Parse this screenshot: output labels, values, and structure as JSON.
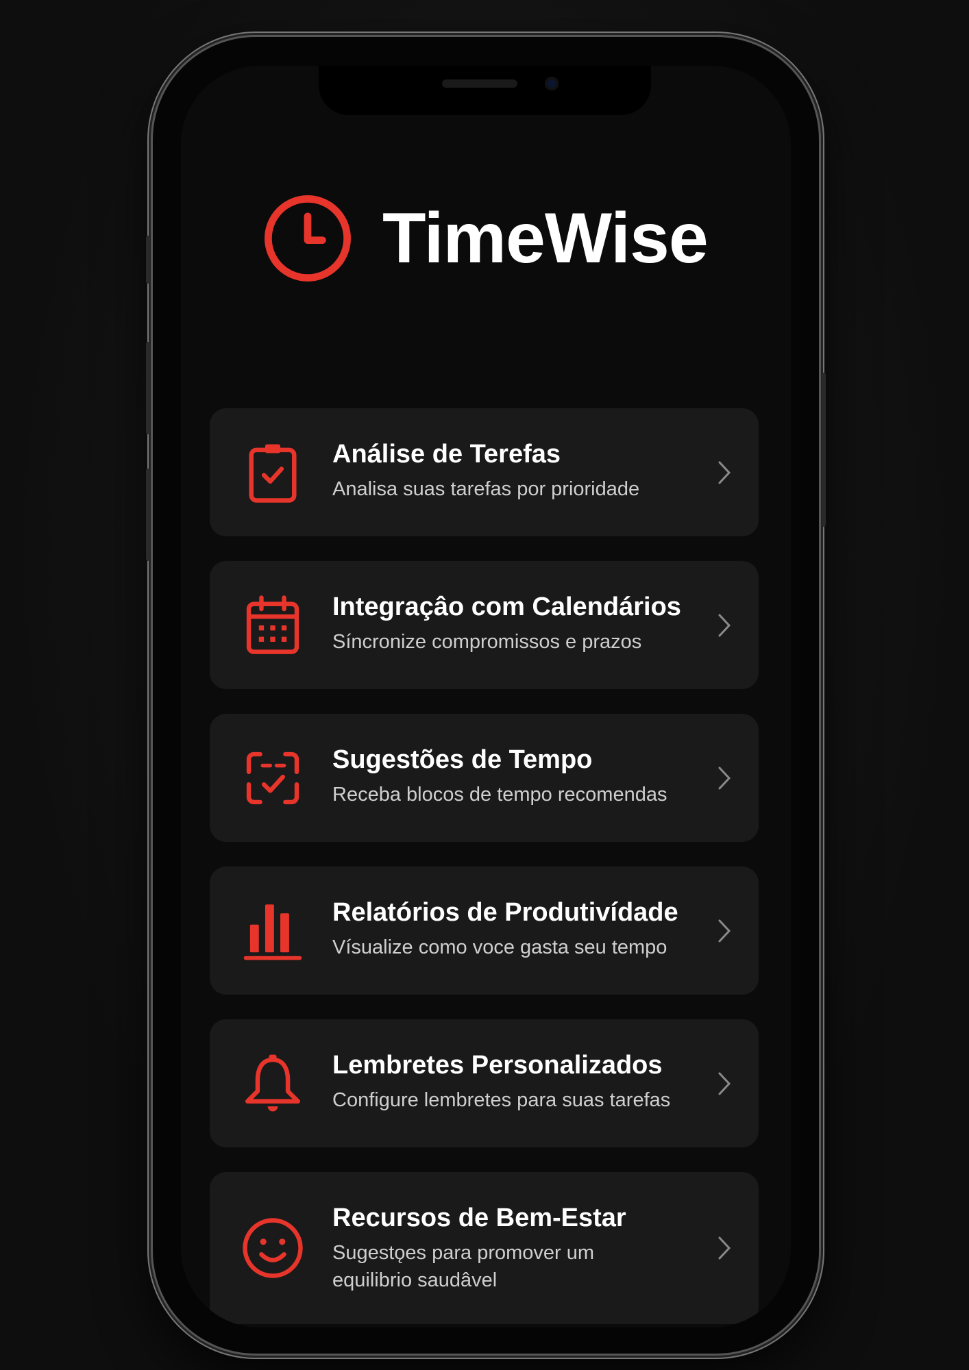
{
  "app": {
    "title": "TimeWise",
    "accent_color": "#e8352b",
    "logo_icon": "clock-icon"
  },
  "features": [
    {
      "title": "Análise de Terefas",
      "subtitle": "Analisa suas tarefas por prioridade",
      "icon": "clipboard-check-icon"
    },
    {
      "title": "Integraçâo com Calendários",
      "subtitle": "Síncronize compromissos e prazos",
      "icon": "calendar-icon"
    },
    {
      "title": "Sugestões de Tempo",
      "subtitle": "Receba blocos de tempo recomendas",
      "icon": "time-block-check-icon"
    },
    {
      "title": "Relatórios de Produtivídade",
      "subtitle": "Vísualize como voce gasta seu tempo",
      "icon": "bar-chart-icon"
    },
    {
      "title": "Lembretes Personalizados",
      "subtitle": "Configure lembretes para suas tarefas",
      "icon": "bell-icon"
    },
    {
      "title": "Recursos de Bem-Estar",
      "subtitle": "Sugestǫes para promover um",
      "subtitle2": "equilibrio saudâvel",
      "icon": "smiley-icon"
    }
  ]
}
